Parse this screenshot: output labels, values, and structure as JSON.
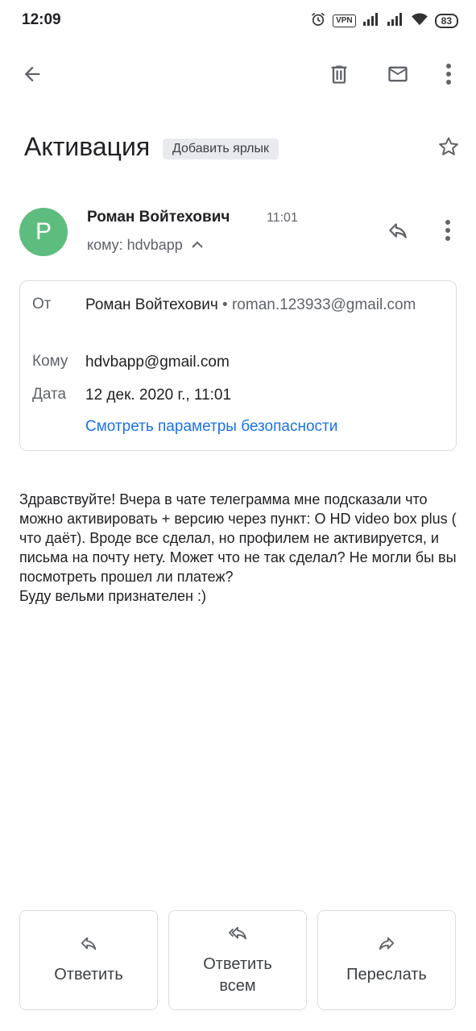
{
  "status_bar": {
    "time": "12:09",
    "vpn": "VPN",
    "battery": "83",
    "icons": [
      "alarm-icon",
      "vpn-icon",
      "signal-icon",
      "signal-icon",
      "wifi-icon",
      "battery-icon"
    ]
  },
  "toolbar": {
    "icons": [
      "back-arrow-icon",
      "trash-icon",
      "mail-icon",
      "more-vertical-icon"
    ]
  },
  "email": {
    "subject": "Активация",
    "add_label": "Добавить ярлык",
    "sender": {
      "avatar_letter": "P",
      "avatar_color": "#5dbd7e",
      "name": "Роман Войтехович",
      "time": "11:01",
      "to_line": "кому: hdvbapp"
    },
    "details": {
      "from_label": "От",
      "from_name": "Роман Войтехович",
      "from_separator": " • ",
      "from_email": "roman.123933@gmail.com",
      "to_label": "Кому",
      "to_value": "hdvbapp@gmail.com",
      "date_label": "Дата",
      "date_value": "12 дек. 2020 г., 11:01",
      "security_link": "Смотреть параметры безопасности"
    },
    "body": "Здравствуйте! Вчера в чате телеграмма мне подсказали что можно активировать + версию через пункт: О HD video box plus ( что даёт). Вроде все сделал, но профилем не активируется, и письма на почту нету. Может что не так сделал? Не могли бы вы посмотреть прошел ли платеж?\nБуду вельми признателен :)"
  },
  "actions": {
    "reply": "Ответить",
    "reply_all": "Ответить всем",
    "forward": "Переслать"
  },
  "colors": {
    "link": "#1a73e8",
    "icon": "#5f6368",
    "border": "#dadce0"
  }
}
